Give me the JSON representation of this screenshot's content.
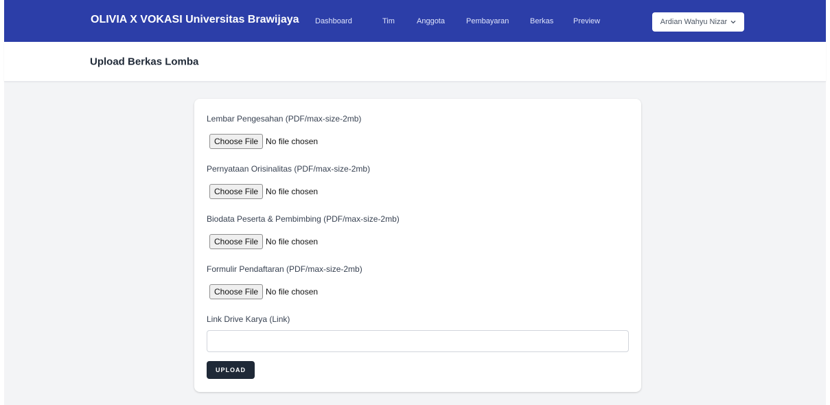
{
  "navbar": {
    "brand": "OLIVIA X VOKASI Universitas Brawijaya",
    "links": [
      "Dashboard",
      "Tim",
      "Anggota",
      "Pembayaran",
      "Berkas",
      "Preview"
    ],
    "user_name": "Ardian Wahyu Nizar",
    "user_icon": "chevron-down-icon",
    "bg_color": "#2c3ea8"
  },
  "header": {
    "title": "Upload Berkas Lomba"
  },
  "form": {
    "fields": [
      {
        "label": "Lembar Pengesahan (PDF/max-size-2mb)",
        "button": "Choose File",
        "status": "No file chosen"
      },
      {
        "label": "Pernyataan Orisinalitas (PDF/max-size-2mb)",
        "button": "Choose File",
        "status": "No file chosen"
      },
      {
        "label": "Biodata Peserta & Pembimbing (PDF/max-size-2mb)",
        "button": "Choose File",
        "status": "No file chosen"
      },
      {
        "label": "Formulir Pendaftaran (PDF/max-size-2mb)",
        "button": "Choose File",
        "status": "No file chosen"
      }
    ],
    "link_label": "Link Drive Karya (Link)",
    "link_value": "",
    "submit_label": "UPLOAD"
  }
}
